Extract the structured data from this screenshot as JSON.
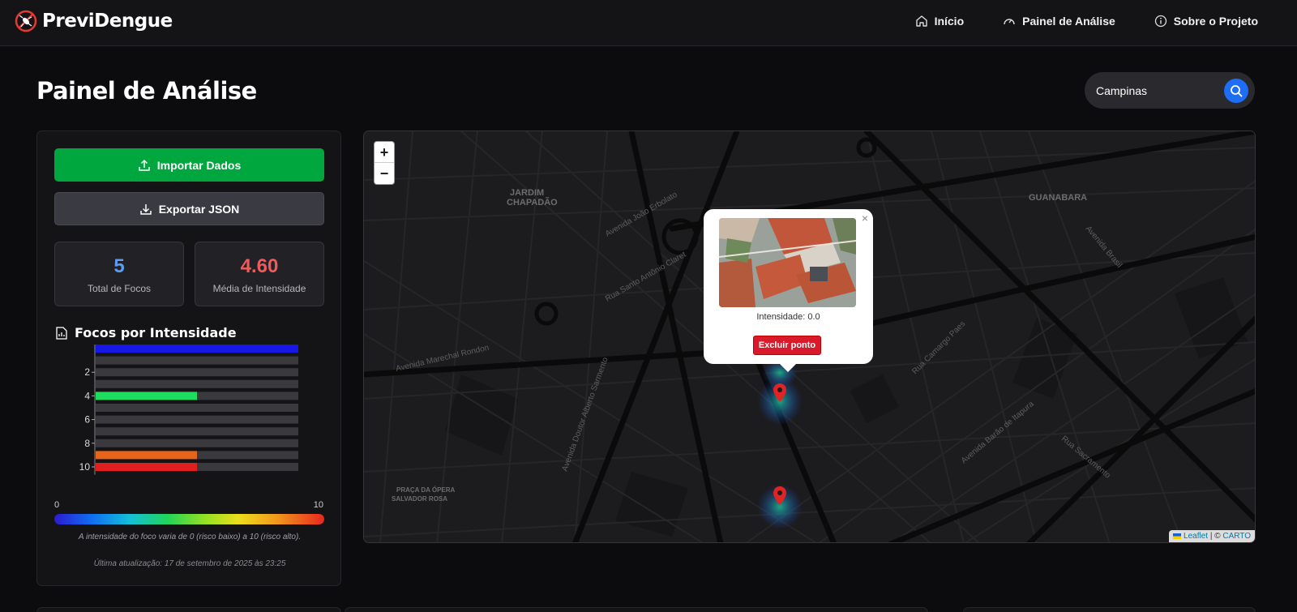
{
  "app": {
    "name": "PreviDengue"
  },
  "nav": [
    {
      "label": "Início",
      "icon": "home-icon"
    },
    {
      "label": "Painel de Análise",
      "icon": "gauge-icon"
    },
    {
      "label": "Sobre o Projeto",
      "icon": "info-icon"
    }
  ],
  "page": {
    "title": "Painel de Análise"
  },
  "search": {
    "value": "Campinas",
    "icon": "search-icon"
  },
  "panel": {
    "import_label": "Importar Dados",
    "export_label": "Exportar JSON",
    "stats": [
      {
        "value": "5",
        "label": "Total de Focos",
        "color": "#5b9cf5"
      },
      {
        "value": "4.60",
        "label": "Média de Intensidade",
        "color": "#ef5b5b"
      }
    ],
    "chart_title": "Focos por Intensidade",
    "gradient": {
      "min": "0",
      "max": "10",
      "note": "A intensidade do foco varia de 0 (risco baixo) a 10 (risco alto)."
    },
    "updated": "Última atualização: 17 de setembro de 2025 às 23:25"
  },
  "chart_data": {
    "type": "bar",
    "orientation": "horizontal",
    "title": "Focos por Intensidade",
    "categories": [
      "0",
      "1",
      "2",
      "3",
      "4",
      "5",
      "6",
      "7",
      "8",
      "9",
      "10"
    ],
    "tick_labels": [
      "",
      "",
      "2",
      "",
      "4",
      "",
      "6",
      "",
      "8",
      "",
      "10"
    ],
    "values": [
      1,
      0,
      0,
      0,
      0.5,
      0,
      0,
      0,
      0,
      0.5,
      0.5
    ],
    "colors": [
      "#1818e6",
      "#3a3a3e",
      "#3a3a3e",
      "#3a3a3e",
      "#1edc5e",
      "#3a3a3e",
      "#3a3a3e",
      "#3a3a3e",
      "#3a3a3e",
      "#e8641a",
      "#e02020"
    ],
    "xlim": [
      0,
      1
    ],
    "grid": false
  },
  "map": {
    "zoom_in": "+",
    "zoom_out": "−",
    "attribution": {
      "leaflet": "Leaflet",
      "separator": " | © ",
      "carto": "CARTO"
    },
    "labels": [
      {
        "text": "JARDIM"
      },
      {
        "text": "CHAPADÃO"
      },
      {
        "text": "GUANABARA"
      },
      {
        "text": "Avenida Marechal Rondon"
      },
      {
        "text": "Avenida João Erbolato"
      },
      {
        "text": "Rua Santo Antônio Claret"
      },
      {
        "text": "Avenida Doutor Alberto Sarmento"
      },
      {
        "text": "Avenida Brasil"
      },
      {
        "text": "Avenida Barão de Itapura"
      },
      {
        "text": "Rua Sacramento"
      },
      {
        "text": "Rua Camargo Paes"
      },
      {
        "text": "PRAÇA DA ÓPERA"
      },
      {
        "text": "SALVADOR ROSA"
      }
    ],
    "popup": {
      "close": "×",
      "intensity": "Intensidade: 0.0",
      "delete_label": "Excluir ponto"
    },
    "pin_color": "#e02424"
  }
}
